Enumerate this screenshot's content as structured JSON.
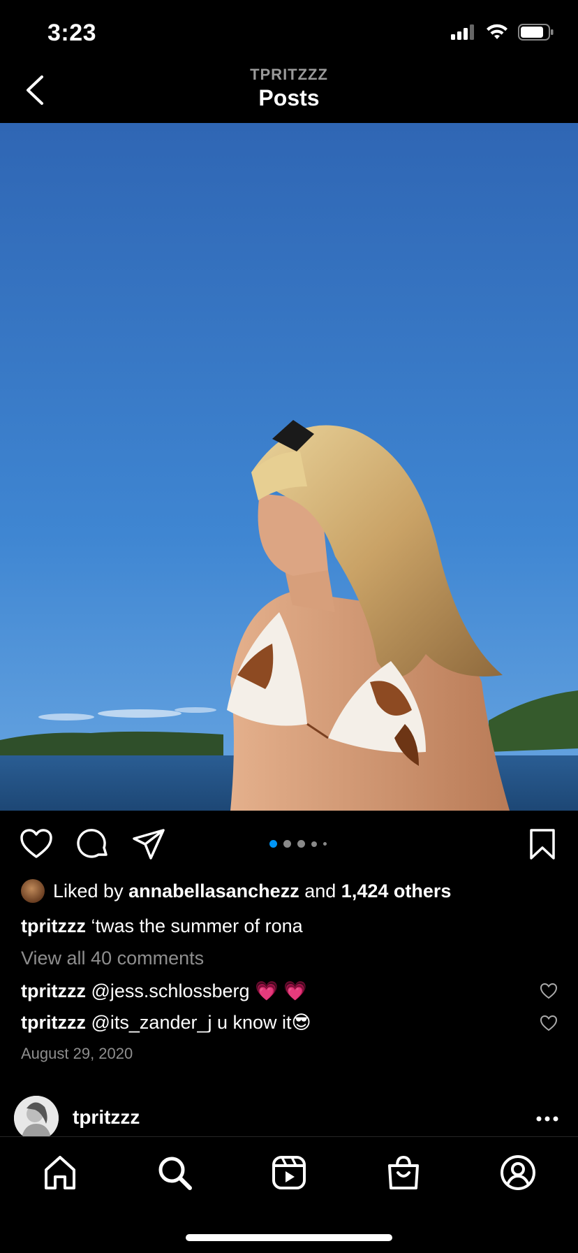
{
  "status_bar": {
    "time": "3:23"
  },
  "header": {
    "subtitle": "TPRITZZZ",
    "title": "Posts"
  },
  "post": {
    "carousel": {
      "count": 5,
      "active_index": 0,
      "active_color": "#0095f6"
    },
    "likes": {
      "prefix": "Liked by",
      "liker": "annabellasanchezz",
      "and": "and",
      "others": "1,424 others"
    },
    "caption": {
      "user": "tpritzzz",
      "text": "‘twas the summer of rona"
    },
    "view_all_comments": "View all 40 comments",
    "comments": [
      {
        "user": "tpritzzz",
        "text": "@jess.schlossberg 💗 💗"
      },
      {
        "user": "tpritzzz",
        "text": "@its_zander_j u know it😎"
      }
    ],
    "date": "August 29, 2020"
  },
  "next_post": {
    "username": "tpritzzz"
  },
  "tabbar": {
    "items": [
      "home-icon",
      "search-icon",
      "reels-icon",
      "shop-icon",
      "profile-icon"
    ]
  },
  "colors": {
    "background": "#000000",
    "accent": "#0095f6",
    "muted_text": "#8e8e8e"
  }
}
